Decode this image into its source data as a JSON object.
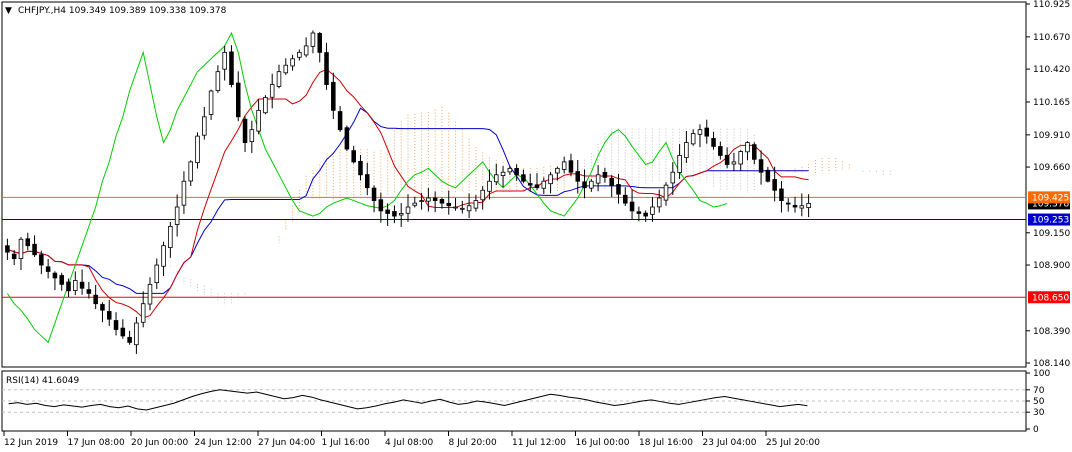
{
  "chart_data": {
    "type": "candlestick",
    "title": "CHFJPY.,H4  109.349 109.389 109.338 109.378",
    "header_arrow": "▼",
    "ylim": [
      108.14,
      110.925
    ],
    "y_ticks": [
      "110.925",
      "110.670",
      "110.420",
      "110.165",
      "109.910",
      "109.660",
      "109.150",
      "108.900",
      "108.390",
      "108.140"
    ],
    "x_ticks": [
      "12 Jun 2019",
      "17 Jun 08:00",
      "20 Jun 00:00",
      "24 Jun 12:00",
      "27 Jun 04:00",
      "1 Jul 16:00",
      "4 Jul 08:00",
      "8 Jul 20:00",
      "11 Jul 12:00",
      "16 Jul 00:00",
      "18 Jul 16:00",
      "23 Jul 04:00",
      "25 Jul 20:00"
    ],
    "price_labels": [
      {
        "value": 109.378,
        "text": "109.378",
        "bg": "#000000",
        "fg": "#ffffff"
      },
      {
        "value": 109.253,
        "text": "109.253",
        "bg": "#0000cc",
        "fg": "#ffffff"
      },
      {
        "value": 108.65,
        "text": "108.650",
        "bg": "#ff0000",
        "fg": "#ffffff"
      },
      {
        "value": 109.425,
        "text": "109.425",
        "bg": "#ff6a00",
        "fg": "#ffffff"
      }
    ],
    "horizontal_lines": [
      {
        "value": 109.425,
        "color": "#ff6a00"
      },
      {
        "value": 109.253,
        "color": "#0000cc"
      },
      {
        "value": 108.65,
        "color": "#ff0000"
      }
    ],
    "close_series": [
      109.0,
      108.95,
      109.1,
      109.05,
      108.98,
      108.9,
      108.85,
      108.8,
      108.75,
      108.7,
      108.78,
      108.72,
      108.68,
      108.6,
      108.55,
      108.48,
      108.4,
      108.35,
      108.3,
      108.45,
      108.6,
      108.75,
      108.9,
      109.05,
      109.2,
      109.35,
      109.55,
      109.7,
      109.9,
      110.05,
      110.25,
      110.4,
      110.55,
      110.3,
      110.05,
      109.85,
      109.95,
      110.1,
      110.2,
      110.3,
      110.4,
      110.45,
      110.5,
      110.55,
      110.6,
      110.7,
      110.55,
      110.3,
      110.1,
      109.95,
      109.8,
      109.7,
      109.6,
      109.5,
      109.4,
      109.32,
      109.3,
      109.28,
      109.3,
      109.35,
      109.38,
      109.4,
      109.42,
      109.4,
      109.38,
      109.36,
      109.35,
      109.34,
      109.36,
      109.4,
      109.48,
      109.55,
      109.6,
      109.62,
      109.65,
      109.6,
      109.55,
      109.52,
      109.5,
      109.55,
      109.6,
      109.65,
      109.7,
      109.62,
      109.55,
      109.5,
      109.55,
      109.6,
      109.58,
      109.52,
      109.45,
      109.38,
      109.32,
      109.3,
      109.28,
      109.35,
      109.42,
      109.52,
      109.62,
      109.75,
      109.85,
      109.92,
      109.95,
      109.9,
      109.82,
      109.75,
      109.68,
      109.7,
      109.78,
      109.85,
      109.72,
      109.62,
      109.55,
      109.48,
      109.4,
      109.38,
      109.35,
      109.36,
      109.378
    ],
    "rsi": {
      "label": "RSI(14) 41.6049",
      "ylim": [
        0,
        100
      ],
      "y_ticks": [
        "100",
        "70",
        "50",
        "30",
        "0"
      ],
      "levels": [
        70,
        50,
        30
      ],
      "values": [
        45,
        47,
        44,
        46,
        42,
        40,
        43,
        41,
        39,
        42,
        44,
        40,
        38,
        41,
        36,
        34,
        38,
        42,
        46,
        52,
        58,
        63,
        67,
        70,
        68,
        66,
        64,
        66,
        62,
        58,
        54,
        56,
        60,
        57,
        52,
        48,
        44,
        40,
        36,
        38,
        41,
        45,
        48,
        52,
        49,
        46,
        50,
        53,
        48,
        44,
        46,
        50,
        48,
        45,
        42,
        46,
        50,
        54,
        58,
        62,
        60,
        57,
        55,
        52,
        48,
        45,
        42,
        44,
        47,
        50,
        52,
        49,
        46,
        44,
        47,
        50,
        53,
        56,
        58,
        55,
        52,
        49,
        46,
        43,
        40,
        42,
        44,
        41.6
      ]
    }
  }
}
